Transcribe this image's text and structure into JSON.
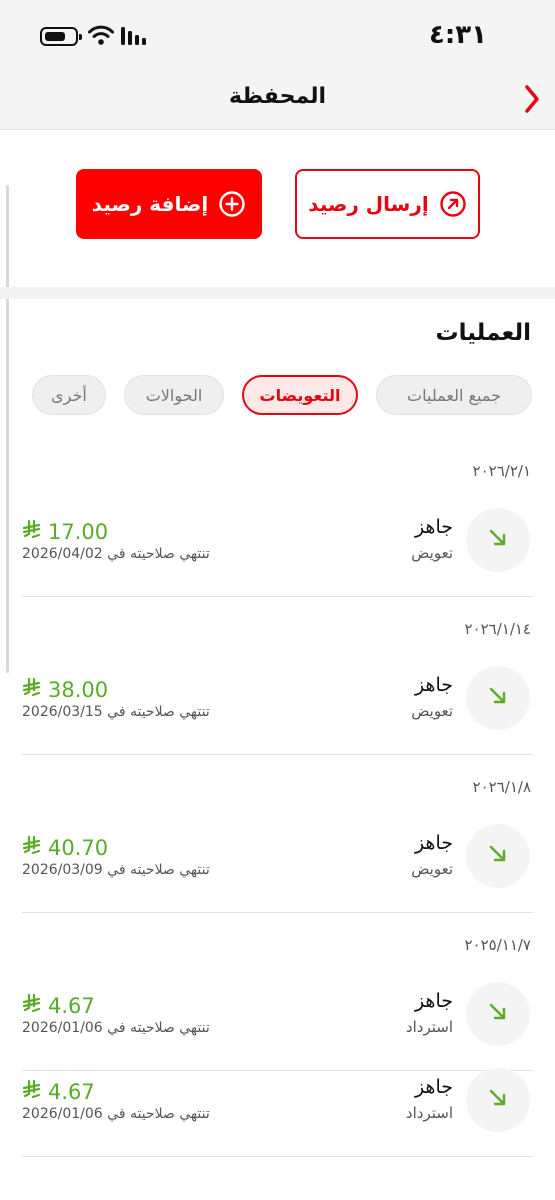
{
  "status_bar": {
    "time": "٤:٣١"
  },
  "header": {
    "title": "المحفظة"
  },
  "actions": {
    "send_label": "إرسال رصيد",
    "add_label": "إضافة رصيد"
  },
  "transactions_section": {
    "title": "العمليات",
    "filters": [
      "جميع العمليات",
      "التعويضات",
      "الحوالات",
      "أخرى"
    ],
    "active_filter": "التعويضات"
  },
  "transactions": [
    {
      "date": "٢٠٢٦/٢/١",
      "status": "جاهز",
      "type": "تعويض",
      "amount": "17.00",
      "expiry": "تنتهي صلاحيته في 2026/04/02"
    },
    {
      "date": "٢٠٢٦/١/١٤",
      "status": "جاهز",
      "type": "تعويض",
      "amount": "38.00",
      "expiry": "تنتهي صلاحيته في 2026/03/15"
    },
    {
      "date": "٢٠٢٦/١/٨",
      "status": "جاهز",
      "type": "تعويض",
      "amount": "40.70",
      "expiry": "تنتهي صلاحيته في 2026/03/09"
    },
    {
      "date": "٢٠٢٥/١١/٧",
      "status": "جاهز",
      "type": "استرداد",
      "amount": "4.67",
      "expiry": "تنتهي صلاحيته في 2026/01/06"
    },
    {
      "date": "",
      "status": "جاهز",
      "type": "استرداد",
      "amount": "4.67",
      "expiry": "تنتهي صلاحيته في 2026/01/06"
    }
  ],
  "colors": {
    "brand_red": "#e30613",
    "amount_green": "#5aab28"
  },
  "icons": {
    "back": "chevron-right-icon",
    "send": "arrow-up-right-circle-icon",
    "add": "plus-circle-icon",
    "incoming": "arrow-down-right-icon",
    "currency": "riyal-icon"
  }
}
